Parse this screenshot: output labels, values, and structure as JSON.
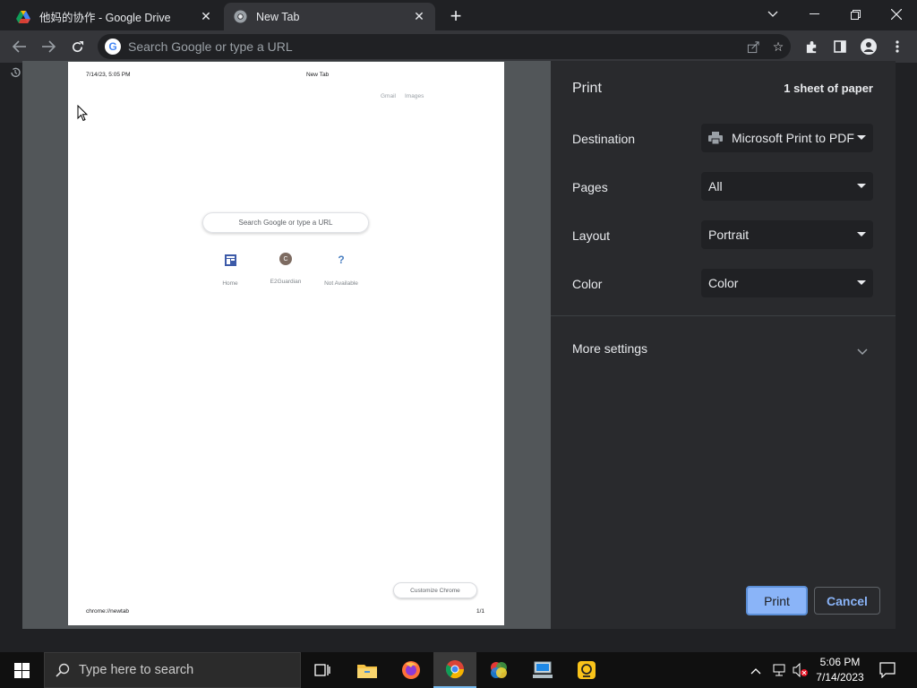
{
  "tabs": [
    {
      "title": "他妈的协作 - Google Drive"
    },
    {
      "title": "New Tab"
    }
  ],
  "omnibox": {
    "placeholder": "Search Google or type a URL"
  },
  "preview": {
    "header_date": "7/14/23, 5:05 PM",
    "header_title": "New Tab",
    "top_links": [
      "Gmail",
      "Images"
    ],
    "search_placeholder": "Search Google or type a URL",
    "shortcuts": [
      {
        "label": "Home",
        "icon": "home-tile-icon"
      },
      {
        "label": "E2Guardian",
        "icon": "letter-c-icon",
        "letter": "C"
      },
      {
        "label": "Not Available",
        "icon": "question-icon",
        "letter": "?"
      }
    ],
    "customize_label": "Customize Chrome",
    "footer_url": "chrome://newtab",
    "footer_page": "1/1"
  },
  "print": {
    "title": "Print",
    "sheets": "1 sheet of paper",
    "settings": [
      {
        "label": "Destination",
        "value": "Microsoft Print to PDF"
      },
      {
        "label": "Pages",
        "value": "All"
      },
      {
        "label": "Layout",
        "value": "Portrait"
      },
      {
        "label": "Color",
        "value": "Color"
      }
    ],
    "more_settings": "More settings",
    "print_button": "Print",
    "cancel_button": "Cancel"
  },
  "taskbar": {
    "search_placeholder": "Type here to search",
    "time": "5:06 PM",
    "date": "7/14/2023"
  },
  "colors": {
    "accent": "#8ab4f8",
    "panel": "#292a2d",
    "toolbar": "#35363a"
  }
}
